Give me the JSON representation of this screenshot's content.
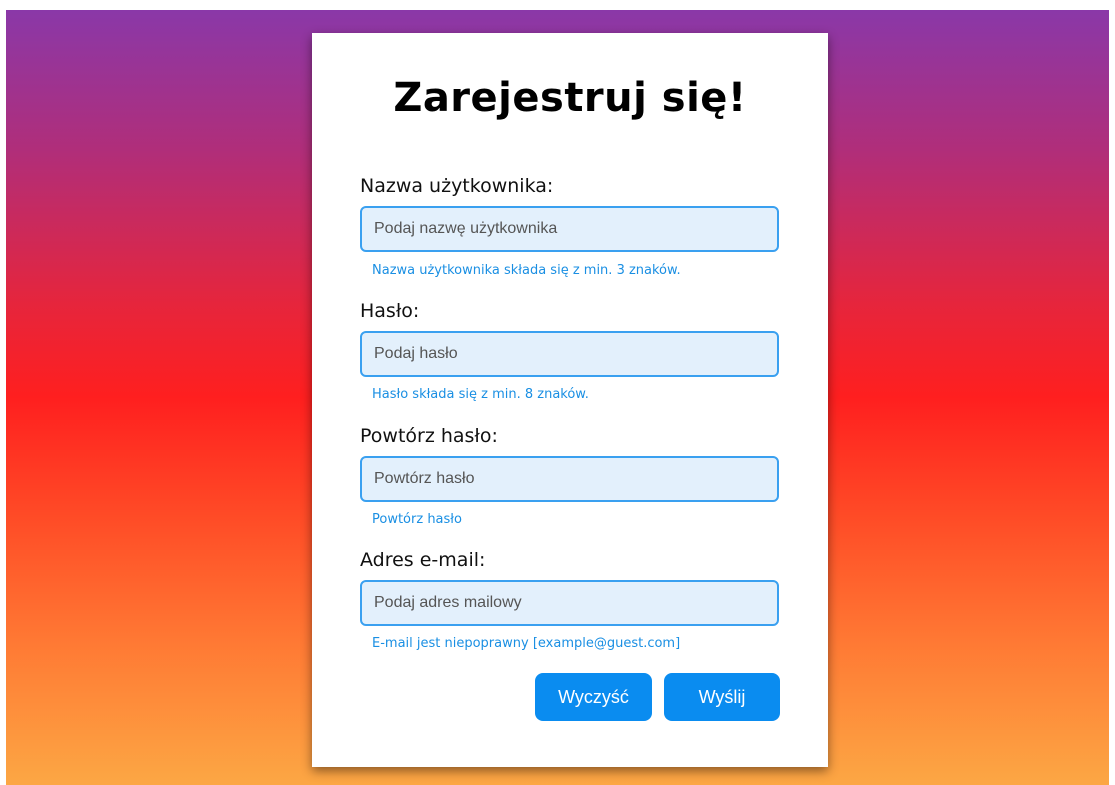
{
  "form": {
    "title": "Zarejestruj się!",
    "username": {
      "label": "Nazwa użytkownika:",
      "placeholder": "Podaj nazwę użytkownika",
      "hint": "Nazwa użytkownika składa się z min. 3 znaków."
    },
    "password": {
      "label": "Hasło:",
      "placeholder": "Podaj hasło",
      "hint": "Hasło składa się z min. 8 znaków."
    },
    "repeat_password": {
      "label": "Powtórz hasło:",
      "placeholder": "Powtórz hasło",
      "hint": "Powtórz hasło"
    },
    "email": {
      "label": "Adres e-mail:",
      "placeholder": "Podaj adres mailowy",
      "hint": "E-mail jest niepoprawny [example@guest.com]"
    },
    "buttons": {
      "clear_label": "Wyczyść",
      "submit_label": "Wyślij"
    }
  },
  "colors": {
    "accent": "#0a8cf0",
    "hint_text": "#1a8fe3",
    "input_background": "#e3f0fc",
    "input_border": "#3aa0f0",
    "gradient_top": "#8a38a8",
    "gradient_middle": "#ff1f1f",
    "gradient_bottom": "#fca744"
  }
}
